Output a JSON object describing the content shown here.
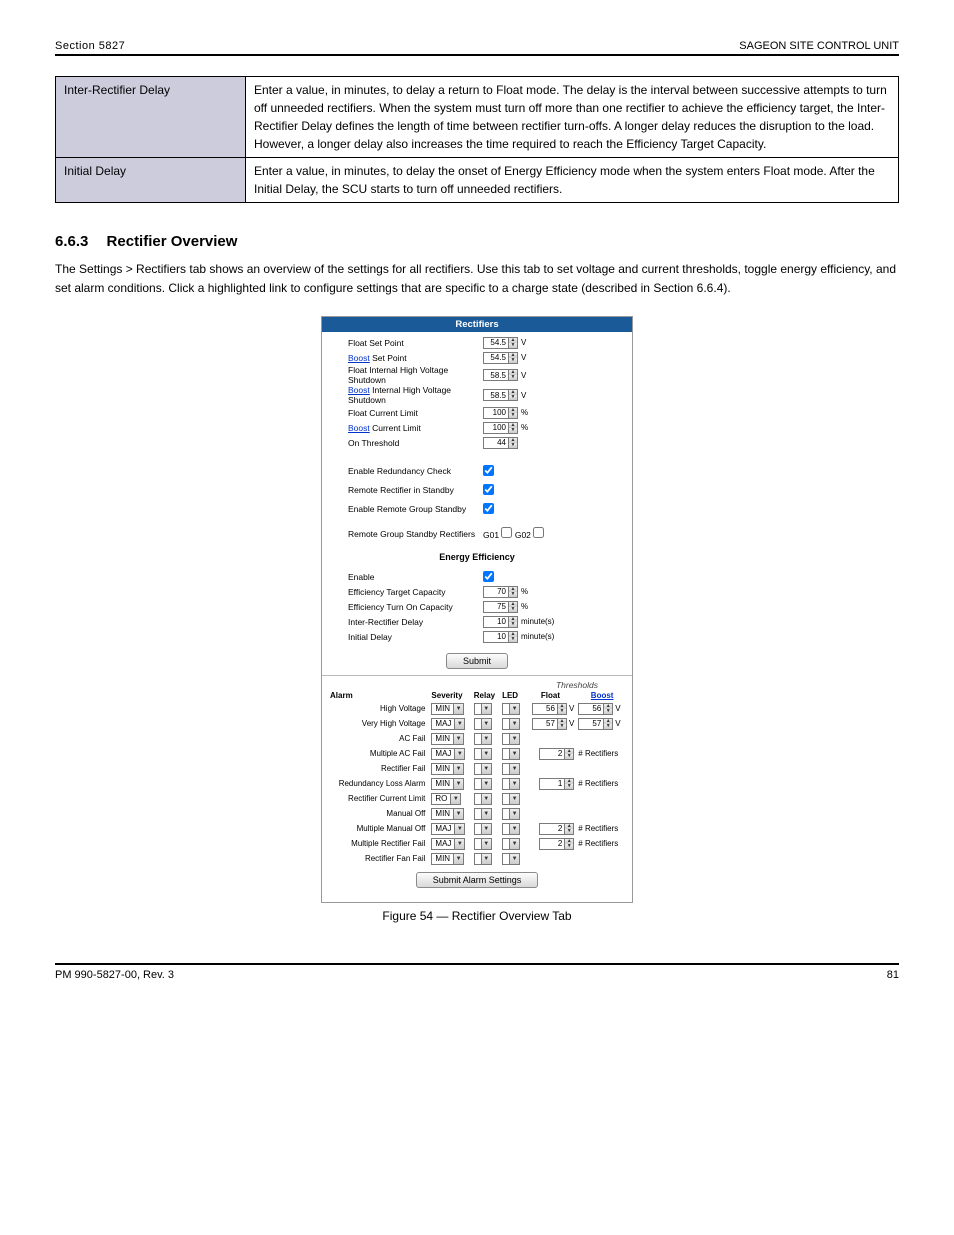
{
  "header": {
    "left": "Section 5827",
    "right": "SAGEON SITE CONTROL UNIT"
  },
  "defs": [
    {
      "term": "Inter-Rectifier Delay",
      "desc": "Enter a value, in minutes, to delay a return to Float mode. The delay is the interval between successive attempts to turn off unneeded rectifiers. When the system must turn off more than one rectifier to achieve the efficiency target, the Inter-Rectifier Delay defines the length of time between rectifier turn-offs. A longer delay reduces the disruption to the load. However, a longer delay also increases the time required to reach the Efficiency Target Capacity."
    },
    {
      "term": "Initial Delay",
      "desc": "Enter a value, in minutes, to delay the onset of Energy Efficiency mode when the system enters Float mode. After the Initial Delay, the SCU starts to turn off unneeded rectifiers."
    }
  ],
  "sections": {
    "overview_heading_num": "6.6.3",
    "overview_heading": "Rectifier Overview",
    "overview_body": "The Settings > Rectifiers tab shows an overview of the settings for all rectifiers. Use this tab to set voltage and current thresholds, toggle energy efficiency, and set alarm conditions. Click a highlighted link to configure settings that are specific to a charge state (described in Section 6.6.4)."
  },
  "ui": {
    "title": "Rectifiers",
    "rows": [
      {
        "label_pre": "",
        "label": "Float Set Point",
        "value": "54.5",
        "unit": "V",
        "link": false
      },
      {
        "label_pre": "Boost",
        "label": " Set Point",
        "value": "54.5",
        "unit": "V",
        "link": true
      },
      {
        "label_pre": "",
        "label": "Float Internal High Voltage Shutdown",
        "value": "58.5",
        "unit": "V",
        "link": false
      },
      {
        "label_pre": "Boost",
        "label": " Internal High Voltage Shutdown",
        "value": "58.5",
        "unit": "V",
        "link": true
      },
      {
        "label_pre": "",
        "label": "Float Current Limit",
        "value": "100",
        "unit": "%",
        "link": false
      },
      {
        "label_pre": "Boost",
        "label": " Current Limit",
        "value": "100",
        "unit": "%",
        "link": true
      },
      {
        "label_pre": "",
        "label": "On Threshold",
        "value": "44",
        "unit": "",
        "link": false
      }
    ],
    "checks": [
      {
        "label": "Enable Redundancy Check",
        "checked": true
      },
      {
        "label": "Remote Rectifier in Standby",
        "checked": true
      },
      {
        "label": "Enable Remote Group Standby",
        "checked": true
      }
    ],
    "standby": {
      "label": "Remote Group Standby Rectifiers",
      "g1": "G01",
      "g2": "G02"
    },
    "ee_head": "Energy Efficiency",
    "ee": [
      {
        "label": "Enable",
        "type": "check",
        "checked": true
      },
      {
        "label": "Efficiency Target Capacity",
        "type": "spin",
        "value": "70",
        "unit": "%"
      },
      {
        "label": "Efficiency Turn On Capacity",
        "type": "spin",
        "value": "75",
        "unit": "%"
      },
      {
        "label": "Inter-Rectifier Delay",
        "type": "spin",
        "value": "10",
        "unit": "minute(s)"
      },
      {
        "label": "Initial Delay",
        "type": "spin",
        "value": "10",
        "unit": "minute(s)"
      }
    ],
    "submit": "Submit",
    "thresholds_label": "Thresholds",
    "alarm_headers": {
      "alarm": "Alarm",
      "severity": "Severity",
      "relay": "Relay",
      "led": "LED",
      "float": "Float",
      "boost": "Boost"
    },
    "alarms": [
      {
        "name": "High Voltage",
        "sev": "MIN",
        "float": "56",
        "floatU": "V",
        "boost": "56",
        "boostU": "V",
        "note": ""
      },
      {
        "name": "Very High Voltage",
        "sev": "MAJ",
        "float": "57",
        "floatU": "V",
        "boost": "57",
        "boostU": "V",
        "note": ""
      },
      {
        "name": "AC Fail",
        "sev": "MIN",
        "float": "",
        "floatU": "",
        "boost": "",
        "boostU": "",
        "note": ""
      },
      {
        "name": "Multiple AC Fail",
        "sev": "MAJ",
        "float": "2",
        "floatU": "",
        "boost": "",
        "boostU": "",
        "note": "# Rectifiers"
      },
      {
        "name": "Rectifier Fail",
        "sev": "MIN",
        "float": "",
        "floatU": "",
        "boost": "",
        "boostU": "",
        "note": ""
      },
      {
        "name": "Redundancy Loss Alarm",
        "sev": "MIN",
        "float": "1",
        "floatU": "",
        "boost": "",
        "boostU": "",
        "note": "# Rectifiers"
      },
      {
        "name": "Rectifier Current Limit",
        "sev": "RO",
        "float": "",
        "floatU": "",
        "boost": "",
        "boostU": "",
        "note": ""
      },
      {
        "name": "Manual Off",
        "sev": "MIN",
        "float": "",
        "floatU": "",
        "boost": "",
        "boostU": "",
        "note": ""
      },
      {
        "name": "Multiple Manual Off",
        "sev": "MAJ",
        "float": "2",
        "floatU": "",
        "boost": "",
        "boostU": "",
        "note": "# Rectifiers"
      },
      {
        "name": "Multiple Rectifier Fail",
        "sev": "MAJ",
        "float": "2",
        "floatU": "",
        "boost": "",
        "boostU": "",
        "note": "# Rectifiers"
      },
      {
        "name": "Rectifier Fan Fail",
        "sev": "MIN",
        "float": "",
        "floatU": "",
        "boost": "",
        "boostU": "",
        "note": ""
      }
    ],
    "submit_alarm": "Submit Alarm Settings"
  },
  "figure_caption": "Figure 54 — Rectifier Overview Tab",
  "footer": {
    "left": "PM 990-5827-00, Rev. 3",
    "right": "81"
  }
}
